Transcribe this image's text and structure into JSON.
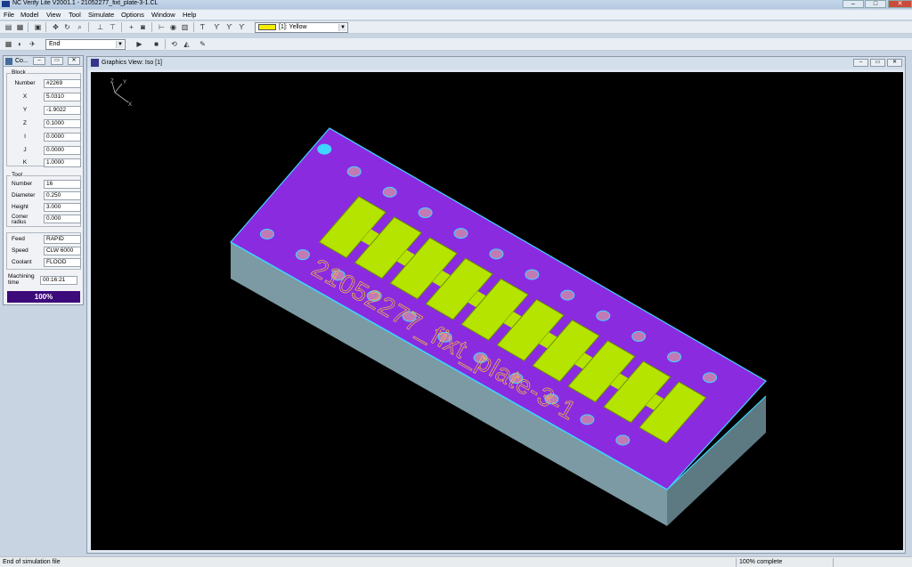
{
  "window": {
    "title": "NC Verify Lite  V2001.1 - 21052277_fixt_plate-3-1.CL"
  },
  "menu": [
    "File",
    "Model",
    "View",
    "Tool",
    "Simulate",
    "Options",
    "Window",
    "Help"
  ],
  "toolbar": {
    "color_select": "[1]: Yellow",
    "color_swatch": "#f4ee00",
    "mode_select": "End"
  },
  "control_panel": {
    "title": "Co...",
    "block": {
      "legend": "Block",
      "fields": [
        {
          "label": "Number",
          "value": "#2269"
        },
        {
          "label": "X",
          "value": "5.0310"
        },
        {
          "label": "Y",
          "value": "-1.9022"
        },
        {
          "label": "Z",
          "value": "0.1000"
        },
        {
          "label": "I",
          "value": "0.0000"
        },
        {
          "label": "J",
          "value": "0.0000"
        },
        {
          "label": "K",
          "value": "1.0000"
        }
      ]
    },
    "tool": {
      "legend": "Tool",
      "fields": [
        {
          "label": "Number",
          "value": "16"
        },
        {
          "label": "Diameter",
          "value": "0.250"
        },
        {
          "label": "Height",
          "value": "3.000"
        },
        {
          "label": "Corner radius",
          "value": "0.000"
        }
      ]
    },
    "motion": {
      "fields": [
        {
          "label": "Feed",
          "value": "RAPID"
        },
        {
          "label": "Speed",
          "value": "CLW 6000"
        },
        {
          "label": "Coolant",
          "value": "FLOOD"
        }
      ]
    },
    "machining_time": {
      "label": "Machining time",
      "value": "00:16:21"
    },
    "progress": {
      "label": "100%",
      "value": 100
    }
  },
  "graphics_view": {
    "title": "Graphics View: Iso [1]",
    "axis_labels": {
      "y": "Y",
      "z": "Z",
      "x": "X"
    },
    "part_engraving": "21052277_fixt_plate-3-1",
    "colors": {
      "top": "#8a2be2",
      "side_front": "#7a9aa3",
      "side_right": "#5f7d86",
      "pocket": "#b4e400",
      "hole": "#c27ab7",
      "edge": "#3fd6ff"
    }
  },
  "status": {
    "message": "End of simulation file",
    "progress_text": "100% complete"
  }
}
